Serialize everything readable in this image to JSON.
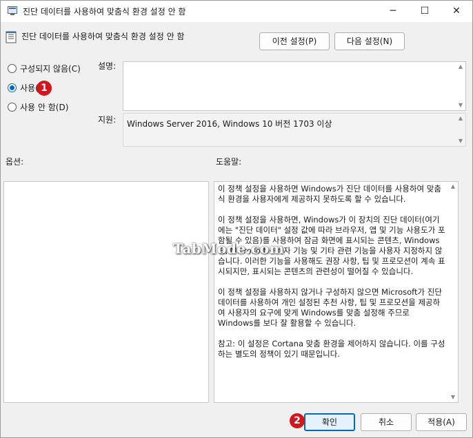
{
  "window": {
    "title": "진단 데이터를 사용하여 맞춤식 환경 설정 안 함",
    "controls": [
      "─",
      "☐",
      "✕"
    ]
  },
  "header": {
    "title": "진단 데이터를 사용하여 맞춤식 환경 설정 안 함",
    "prev_button": "이전 설정(P)",
    "next_button": "다음 설정(N)"
  },
  "radios": [
    {
      "label": "구성되지 않음(C)",
      "selected": false
    },
    {
      "label": "사용(E)",
      "selected": true
    },
    {
      "label": "사용 안 함(D)",
      "selected": false
    }
  ],
  "comment": {
    "label": "설명:",
    "value": ""
  },
  "supported": {
    "label": "지원:",
    "value": "Windows Server 2016, Windows 10 버전 1703 이상"
  },
  "options_label": "옵션:",
  "help_label": "도움말:",
  "help_paragraphs": [
    "이 정책 설정을 사용하면 Windows가 진단 데이터를 사용하여 맞춤식 환경을 사용자에게 제공하지 못하도록 할 수 있습니다.",
    "이 정책 설정을 사용하면, Windows가 이 장치의 진단 데이터(여기에는 \"진단 데이터\" 설정 값에 따라 브라우저, 앱 및 기능 사용도가 포함될 수 있음)를 사용하여 잠금 화면에 표시되는 콘텐츠, Windows 팁, Microsoft 소비자 기능 및 기타 관련 기능을 사용자 지정하지 않습니다. 이러한 기능을 사용해도 권장 사항, 팁 및 프로모션이 계속 표시되지만, 표시되는 콘텐츠의 관련성이 떨어질 수 있습니다.",
    "이 정책 설정을 사용하지 않거나 구성하지 않으면 Microsoft가 진단 데이터를 사용하여 개인 설정된 추천 사항, 팁 및 프로모션을 제공하여 사용자의 요구에 맞게 Windows를 맞춤 설정해 주므로 Windows를 보다 잘 활용할 수 있습니다.",
    "참고: 이 설정은 Cortana 맞춤 환경을 제어하지 않습니다. 이를 구성하는 별도의 정책이 있기 때문입니다."
  ],
  "footer": {
    "ok": "확인",
    "cancel": "취소",
    "apply": "적용(A)"
  },
  "badges": {
    "one": "1",
    "two": "2"
  },
  "watermark": "TabMode.com",
  "colors": {
    "accent": "#0067c0",
    "badge": "#d1171c"
  }
}
